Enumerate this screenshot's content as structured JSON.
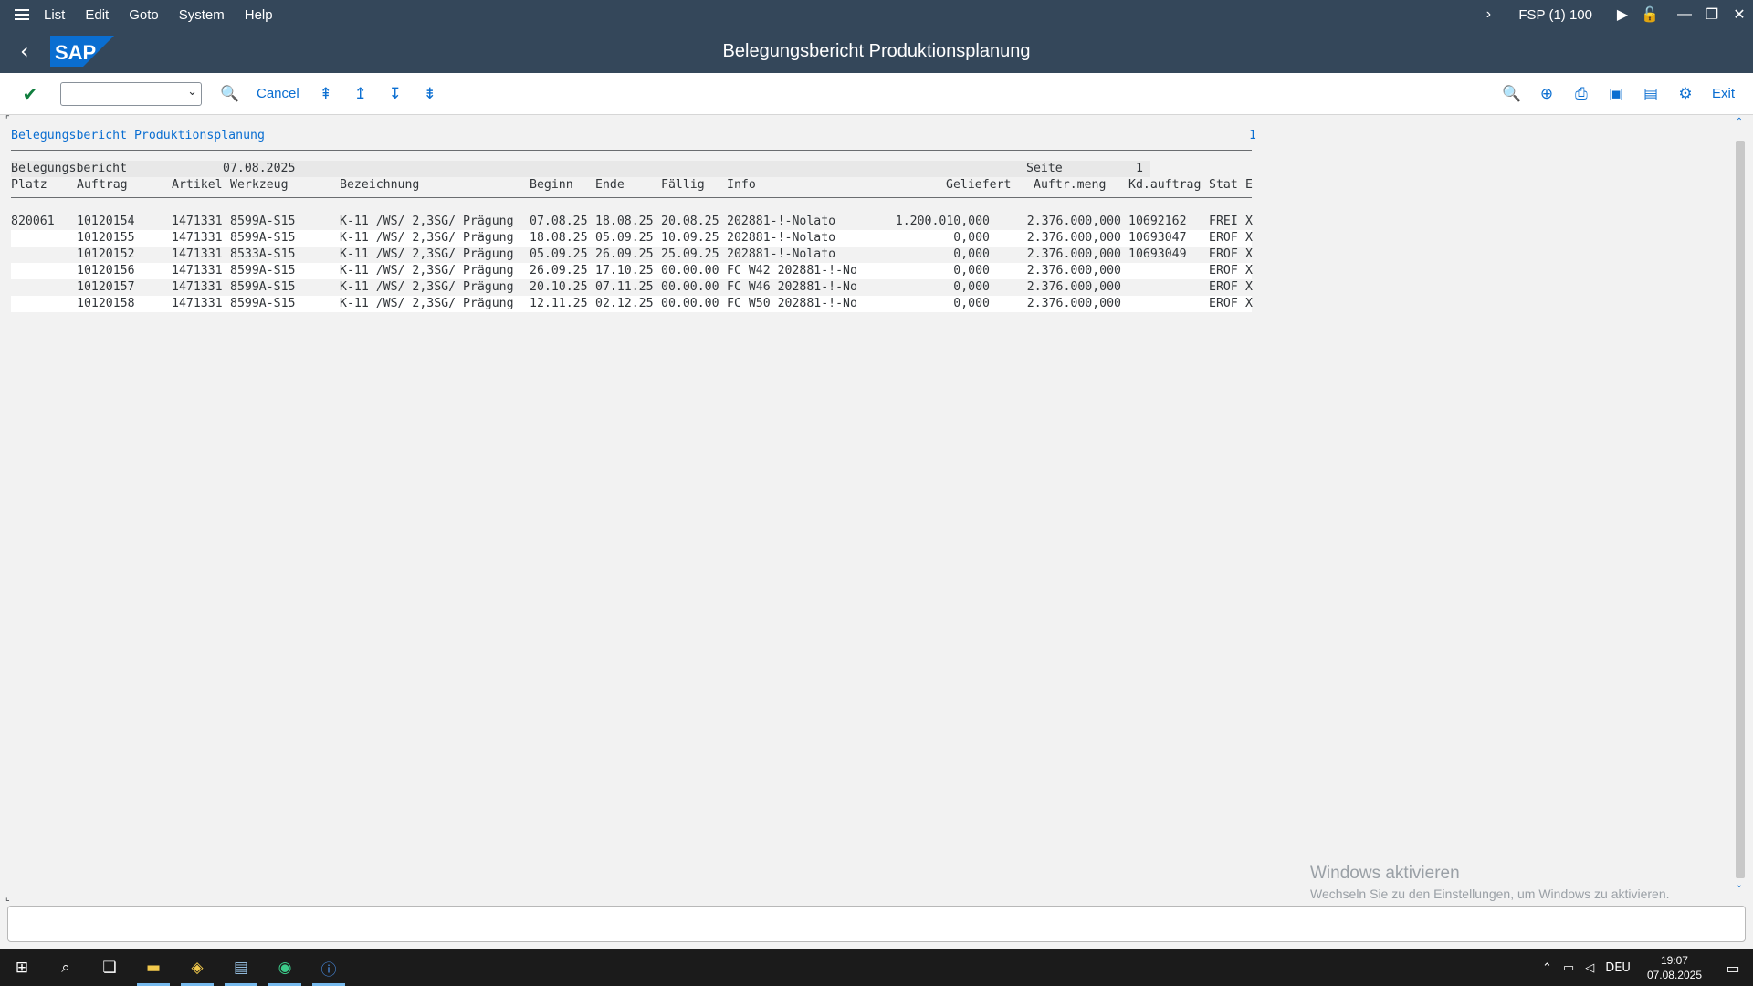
{
  "menu": {
    "items": [
      {
        "label": "List",
        "key": "list"
      },
      {
        "label": "Edit",
        "key": "edit"
      },
      {
        "label": "Goto",
        "key": "goto"
      },
      {
        "label": "System",
        "key": "system"
      },
      {
        "label": "Help",
        "key": "help"
      }
    ],
    "system_info": "FSP (1) 100"
  },
  "titlebar": {
    "title": "Belegungsbericht Produktionsplanung",
    "logo_text": "SAP"
  },
  "toolbar": {
    "cancel_label": "Cancel",
    "exit_label": "Exit",
    "command_field_value": ""
  },
  "report": {
    "title": "Belegungsbericht Produktionsplanung",
    "page_number_top": "1",
    "header_label": "Belegungsbericht",
    "date": "07.08.2025",
    "seite_label": "Seite",
    "seite_value": "1",
    "columns": {
      "platz": "Platz",
      "auftrag": "Auftrag",
      "artikel": "Artikel",
      "werkzeug": "Werkzeug",
      "bezeichnung": "Bezeichnung",
      "beginn": "Beginn",
      "ende": "Ende",
      "faellig": "Fällig",
      "info": "Info",
      "geliefert": "Geliefert",
      "auftr_meng": "Auftr.meng",
      "kd_auftrag": "Kd.auftrag",
      "stat": "Stat",
      "e": "E"
    },
    "rows": [
      {
        "platz": "820061",
        "auftrag": "10120154",
        "artikel": "1471331",
        "werkzeug": "8599A-S15",
        "bezeichnung": "K-11 /WS/ 2,3SG/ Prägung",
        "beginn": "07.08.25",
        "ende": "18.08.25",
        "faellig": "20.08.25",
        "info": "202881-!-Nolato",
        "geliefert": "1.200.010,000",
        "auftr_meng": "2.376.000,000",
        "kd_auftrag": "10692162",
        "stat": "FREI",
        "e": "X"
      },
      {
        "platz": "",
        "auftrag": "10120155",
        "artikel": "1471331",
        "werkzeug": "8599A-S15",
        "bezeichnung": "K-11 /WS/ 2,3SG/ Prägung",
        "beginn": "18.08.25",
        "ende": "05.09.25",
        "faellig": "10.09.25",
        "info": "202881-!-Nolato",
        "geliefert": "0,000",
        "auftr_meng": "2.376.000,000",
        "kd_auftrag": "10693047",
        "stat": "EROF",
        "e": "X"
      },
      {
        "platz": "",
        "auftrag": "10120152",
        "artikel": "1471331",
        "werkzeug": "8533A-S15",
        "bezeichnung": "K-11 /WS/ 2,3SG/ Prägung",
        "beginn": "05.09.25",
        "ende": "26.09.25",
        "faellig": "25.09.25",
        "info": "202881-!-Nolato",
        "geliefert": "0,000",
        "auftr_meng": "2.376.000,000",
        "kd_auftrag": "10693049",
        "stat": "EROF",
        "e": "X"
      },
      {
        "platz": "",
        "auftrag": "10120156",
        "artikel": "1471331",
        "werkzeug": "8599A-S15",
        "bezeichnung": "K-11 /WS/ 2,3SG/ Prägung",
        "beginn": "26.09.25",
        "ende": "17.10.25",
        "faellig": "00.00.00",
        "info": "FC W42 202881-!-No",
        "geliefert": "0,000",
        "auftr_meng": "2.376.000,000",
        "kd_auftrag": "",
        "stat": "EROF",
        "e": "X"
      },
      {
        "platz": "",
        "auftrag": "10120157",
        "artikel": "1471331",
        "werkzeug": "8599A-S15",
        "bezeichnung": "K-11 /WS/ 2,3SG/ Prägung",
        "beginn": "20.10.25",
        "ende": "07.11.25",
        "faellig": "00.00.00",
        "info": "FC W46 202881-!-No",
        "geliefert": "0,000",
        "auftr_meng": "2.376.000,000",
        "kd_auftrag": "",
        "stat": "EROF",
        "e": "X"
      },
      {
        "platz": "",
        "auftrag": "10120158",
        "artikel": "1471331",
        "werkzeug": "8599A-S15",
        "bezeichnung": "K-11 /WS/ 2,3SG/ Prägung",
        "beginn": "12.11.25",
        "ende": "02.12.25",
        "faellig": "00.00.00",
        "info": "FC W50 202881-!-No",
        "geliefert": "0,000",
        "auftr_meng": "2.376.000,000",
        "kd_auftrag": "",
        "stat": "EROF",
        "e": "X"
      }
    ]
  },
  "watermark": {
    "line1": "Windows aktivieren",
    "line2": "Wechseln Sie zu den Einstellungen, um Windows zu aktivieren."
  },
  "taskbar": {
    "language": "DEU",
    "time": "19:07",
    "date": "07.08.2025"
  },
  "colors": {
    "shell": "#34475a",
    "accent": "#0a6ed1",
    "check": "#107e3e"
  }
}
